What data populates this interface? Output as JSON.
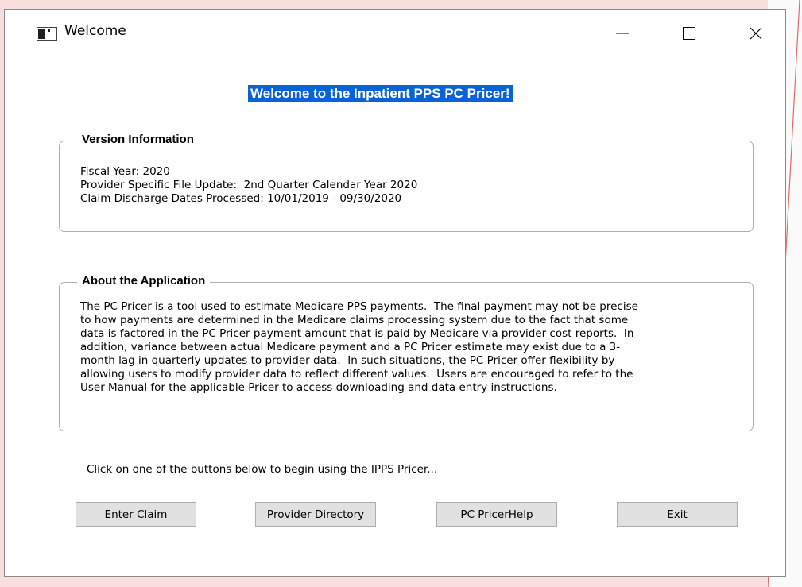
{
  "window": {
    "title": "Welcome"
  },
  "banner": "Welcome to the Inpatient PPS PC Pricer!",
  "version_info": {
    "heading": "Version Information",
    "lines": [
      "Fiscal Year: 2020",
      "Provider Specific File Update:  2nd Quarter Calendar Year 2020",
      "Claim Discharge Dates Processed: 10/01/2019 - 09/30/2020"
    ]
  },
  "about": {
    "heading": "About the Application",
    "lines": [
      "The PC Pricer is a tool used to estimate Medicare PPS payments.  The final payment may not be precise",
      "to how payments are determined in the Medicare claims processing system due to the fact that some",
      "data is factored in the PC Pricer payment amount that is paid by Medicare via provider cost reports.  In",
      "addition, variance between actual Medicare payment and a PC Pricer estimate may exist due to a 3-",
      "month lag in quarterly updates to provider data.  In such situations, the PC Pricer offer flexibility by",
      "allowing users to modify provider data to reflect different values.  Users are encouraged to refer to the",
      "User Manual for the applicable Pricer to access downloading and data entry instructions."
    ]
  },
  "instruction": "Click on one of the buttons below to begin using the IPPS Pricer...",
  "buttons": {
    "enter_claim": {
      "mnemonic": "E",
      "rest": "nter Claim"
    },
    "provider_directory": {
      "mnemonic": "P",
      "rest": "rovider Directory"
    },
    "pc_pricer_help": {
      "before": "PC Pricer ",
      "mnemonic": "H",
      "rest": "elp"
    },
    "exit": {
      "before": "E",
      "mnemonic": "x",
      "rest": "it"
    }
  },
  "icons": {
    "app": "window-app-icon",
    "minimize": "minimize-icon",
    "maximize": "maximize-icon",
    "close": "close-icon"
  },
  "colors": {
    "banner_bg": "#0a63d6",
    "button_bg": "#e1e1e1",
    "desktop_bg": "#f9dede"
  }
}
